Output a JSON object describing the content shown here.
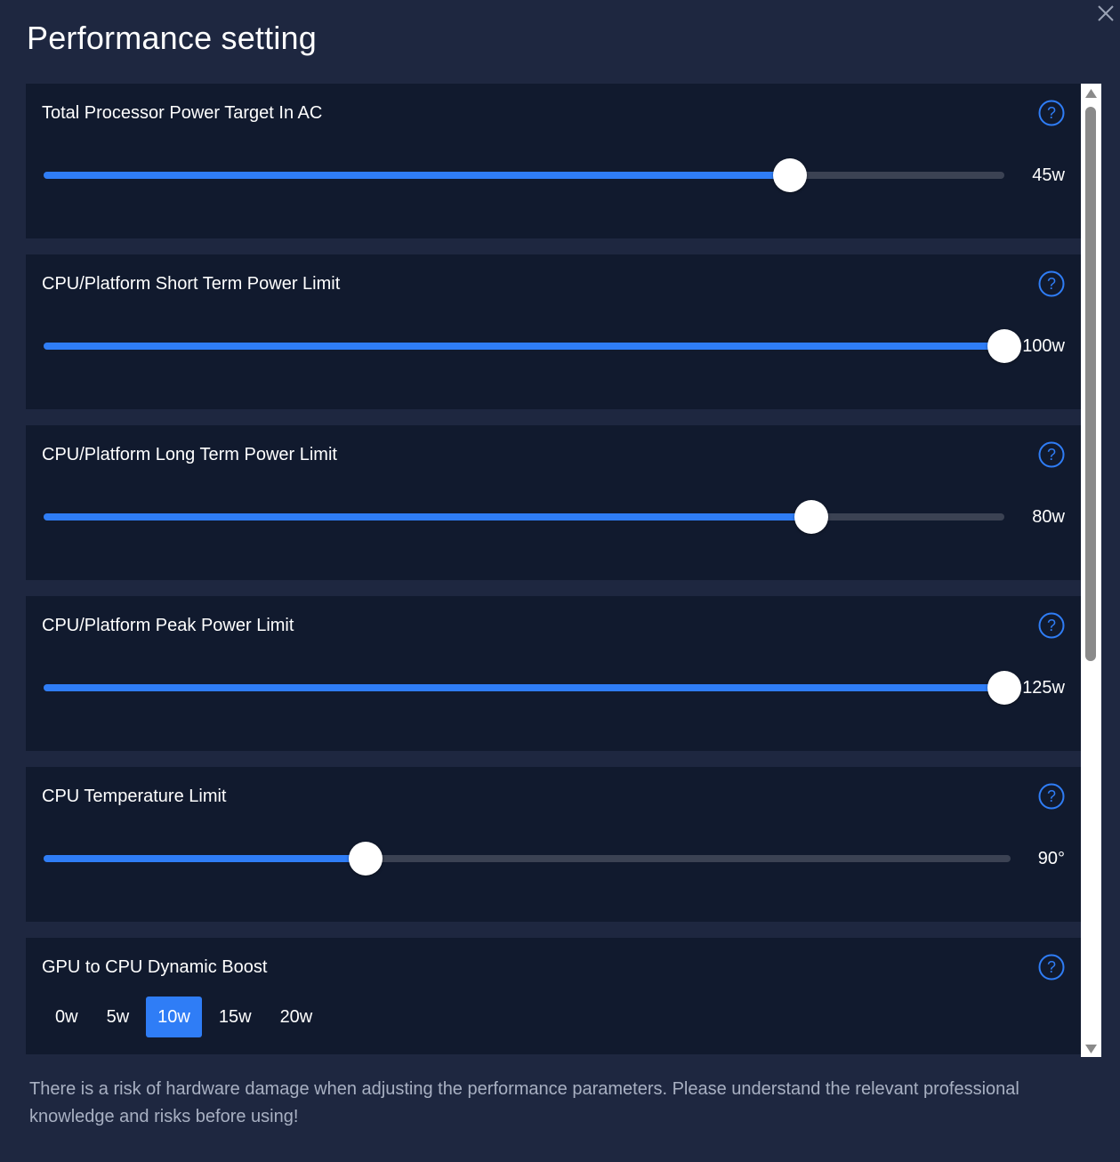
{
  "dialog": {
    "title": "Performance setting",
    "warning": "There is a risk of hardware damage when adjusting the performance parameters. Please understand the relevant professional knowledge and risks before using!"
  },
  "colors": {
    "background": "#1e2740",
    "panel": "#111a2e",
    "accent": "#2f7df6",
    "track": "#3b4253"
  },
  "sliders": [
    {
      "label": "Total Processor Power Target In AC",
      "value_text": "45w",
      "fill_fraction": 0.777
    },
    {
      "label": "CPU/Platform Short Term Power Limit",
      "value_text": "100w",
      "fill_fraction": 1.0
    },
    {
      "label": "CPU/Platform Long Term Power Limit",
      "value_text": "80w",
      "fill_fraction": 0.799
    },
    {
      "label": "CPU/Platform Peak Power Limit",
      "value_text": "125w",
      "fill_fraction": 1.0
    },
    {
      "label": "CPU Temperature Limit",
      "value_text": "90°",
      "fill_fraction": 0.333
    }
  ],
  "boost": {
    "label": "GPU to CPU Dynamic Boost",
    "options": [
      "0w",
      "5w",
      "10w",
      "15w",
      "20w"
    ],
    "selected": "10w"
  },
  "icons": {
    "close": "close-icon",
    "help": "help-circle-icon",
    "scroll_up": "arrow-up-icon",
    "scroll_down": "arrow-down-icon"
  }
}
